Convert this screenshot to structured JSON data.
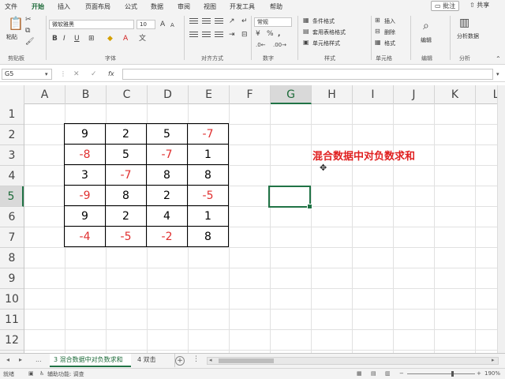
{
  "menu": {
    "tabs": [
      "文件",
      "开始",
      "插入",
      "页面布局",
      "公式",
      "数据",
      "审阅",
      "视图",
      "开发工具",
      "帮助"
    ],
    "active": "开始",
    "comment": "批注",
    "share": "共享"
  },
  "ribbon": {
    "paste": "粘贴",
    "groups": [
      "剪贴板",
      "字体",
      "对齐方式",
      "数字",
      "样式",
      "单元格",
      "编辑",
      "分析"
    ],
    "font_name": "微软雅黑",
    "font_size": "10",
    "number_format": "常规",
    "styles": [
      "条件格式",
      "套用表格格式",
      "单元格样式"
    ],
    "cells": [
      "插入",
      "删除",
      "格式"
    ],
    "edit": "编辑",
    "analyze": "分析数据"
  },
  "formula_bar": {
    "name_box": "G5",
    "fx": "fx"
  },
  "sheet": {
    "columns": [
      "A",
      "B",
      "C",
      "D",
      "E",
      "F",
      "G",
      "H",
      "I",
      "J",
      "K",
      "L"
    ],
    "rows": [
      "1",
      "2",
      "3",
      "4",
      "5",
      "6",
      "7",
      "8",
      "9",
      "10",
      "11",
      "12"
    ],
    "selected_col": "G",
    "selected_row": "5",
    "table": [
      [
        9,
        2,
        5,
        -7
      ],
      [
        -8,
        5,
        -7,
        1
      ],
      [
        3,
        -7,
        8,
        8
      ],
      [
        -9,
        8,
        2,
        -5
      ],
      [
        9,
        2,
        4,
        1
      ],
      [
        -4,
        -5,
        -2,
        8
      ]
    ],
    "title": "混合数据中对负数求和",
    "negative_color": "#e03030"
  },
  "tabs": {
    "active": "3 混合数据中对负数求和",
    "next": "4 双击",
    "ellipsis": "..."
  },
  "status": {
    "ready": "就绪",
    "accessibility": "辅助功能: 调查",
    "zoom": "190%"
  }
}
